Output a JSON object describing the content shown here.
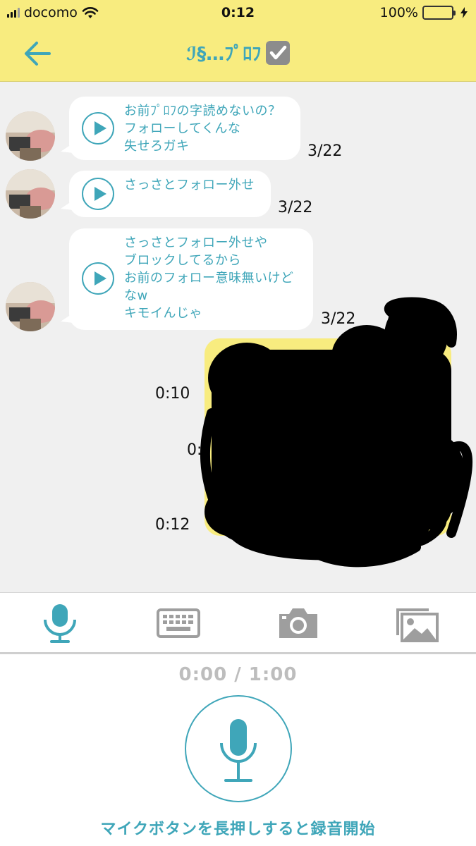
{
  "status_bar": {
    "carrier": "docomo",
    "time": "0:12",
    "battery": "100%",
    "signal_icon": "signal-bars-icon",
    "wifi_icon": "wifi-icon",
    "battery_icon": "battery-icon",
    "charging_icon": "charging-bolt-icon"
  },
  "header": {
    "title": "ℐ§…ﾌﾟﾛﾌ",
    "back_icon": "back-arrow-icon",
    "badge_icon": "check-box-icon"
  },
  "messages": [
    {
      "text": "お前ﾌﾟﾛﾌの字読めないの？\nフォローしてくんな\n失せろガキ",
      "date": "3/22"
    },
    {
      "text": "さっさとフォロー外せ",
      "date": "3/22"
    },
    {
      "text": "さっさとフォロー外せや\nブロックしてるから\nお前のフォロー意味無いけど\nなw\nキモイんじゃ",
      "date": "3/22"
    }
  ],
  "outgoing_durations": [
    "0:10",
    "0:1",
    "0:12"
  ],
  "toolbar": {
    "mic_icon": "microphone-icon",
    "keyboard_icon": "keyboard-icon",
    "camera_icon": "camera-icon",
    "gallery_icon": "image-gallery-icon"
  },
  "recorder": {
    "timer": "0:00 / 1:00",
    "button_icon": "microphone-icon",
    "hint": "マイクボタンを長押しすると録音開始"
  },
  "colors": {
    "accent": "#3fa6b9",
    "header_bg": "#f8ec7f",
    "chat_bg": "#f0f0f0",
    "inactive_icon": "#9e9e9e"
  }
}
